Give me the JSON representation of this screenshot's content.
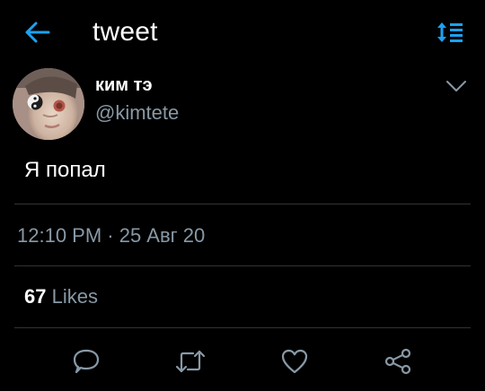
{
  "header": {
    "title": "tweet",
    "back_icon": "arrow-left-icon",
    "sort_icon": "sort-icon",
    "accent": "#1da1f2"
  },
  "tweet": {
    "author_name": "ким тэ",
    "author_handle": "@kimtete",
    "text": "Я попал",
    "timestamp": "12:10 PM · 25 Авг 20",
    "likes_count": "67",
    "likes_label": "Likes"
  },
  "actions": [
    {
      "icon": "reply-icon"
    },
    {
      "icon": "retweet-icon"
    },
    {
      "icon": "like-icon"
    },
    {
      "icon": "share-icon"
    }
  ],
  "colors": {
    "background": "#000000",
    "text_primary": "#ffffff",
    "text_secondary": "#8899a6",
    "divider": "#2f3336",
    "icon": "#8899a6"
  }
}
